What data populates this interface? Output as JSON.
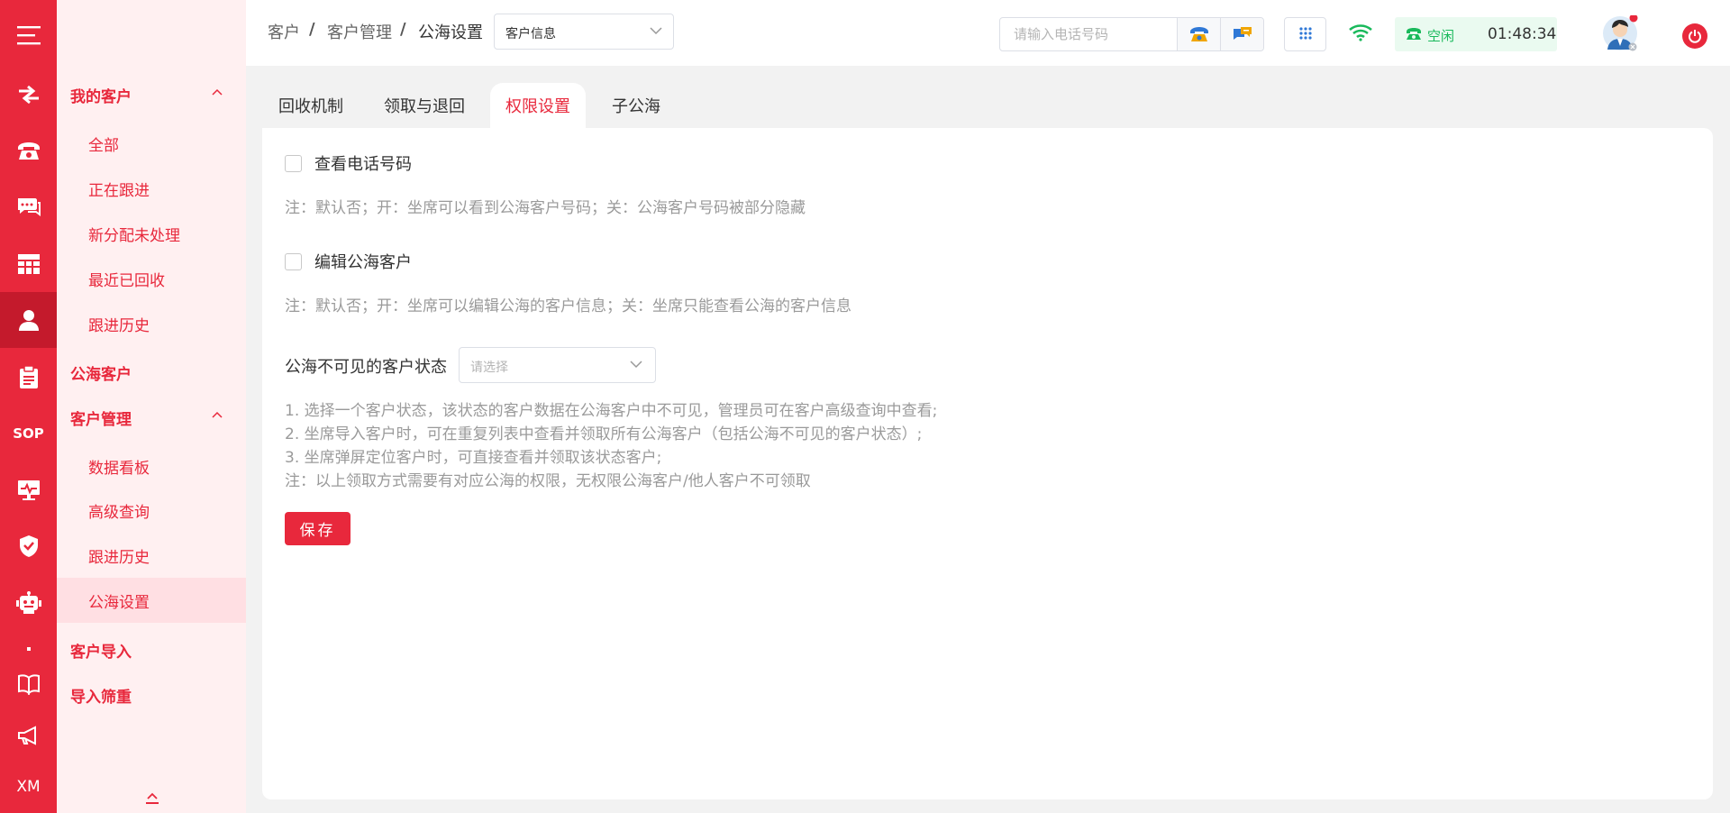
{
  "breadcrumb": {
    "level1": "客户",
    "level2": "客户管理",
    "level3": "公海设置",
    "separator": "/"
  },
  "top_select": {
    "value": "客户信息"
  },
  "phone_search": {
    "placeholder": "请输入电话号码"
  },
  "agent_status": {
    "label": "空闲",
    "time": "01:48:34",
    "color": "#19b95b"
  },
  "rail": {
    "sop_label": "SOP",
    "xm_label": "XM"
  },
  "menu": {
    "my_customers": {
      "label": "我的客户",
      "items": [
        "全部",
        "正在跟进",
        "新分配未处理",
        "最近已回收",
        "跟进历史"
      ]
    },
    "public_customers": {
      "label": "公海客户"
    },
    "customer_management": {
      "label": "客户管理",
      "items": [
        "数据看板",
        "高级查询",
        "跟进历史",
        "公海设置"
      ],
      "active_item": "公海设置"
    },
    "customer_import": {
      "label": "客户导入"
    },
    "import_dedupe": {
      "label": "导入筛重"
    }
  },
  "tabs": [
    {
      "label": "回收机制"
    },
    {
      "label": "领取与退回"
    },
    {
      "label": "权限设置",
      "active": true
    },
    {
      "label": "子公海"
    }
  ],
  "permissions": {
    "view_phone": {
      "label": "查看电话号码",
      "checked": false,
      "note": "注：默认否；开：坐席可以看到公海客户号码；关：公海客户号码被部分隐藏"
    },
    "edit_public": {
      "label": "编辑公海客户",
      "checked": false,
      "note": "注：默认否；开：坐席可以编辑公海的客户信息；关：坐席只能查看公海的客户信息"
    },
    "invisible_status": {
      "label": "公海不可见的客户状态",
      "placeholder": "请选择",
      "descriptions": [
        "1. 选择一个客户状态，该状态的客户数据在公海客户中不可见，管理员可在客户高级查询中查看;",
        "2. 坐席导入客户时，可在重复列表中查看并领取所有公海客户（包括公海不可见的客户状态）;",
        "3. 坐席弹屏定位客户时，可直接查看并领取该状态客户;",
        "注：以上领取方式需要有对应公海的权限，无权限公海客户/他人客户不可领取"
      ]
    }
  },
  "save_button": {
    "label": "保存"
  },
  "colors": {
    "brand": "#e8283c",
    "menu_bg": "#fff0f1",
    "menu_active_bg": "#ffdfe3",
    "note": "#9a9a9a"
  }
}
